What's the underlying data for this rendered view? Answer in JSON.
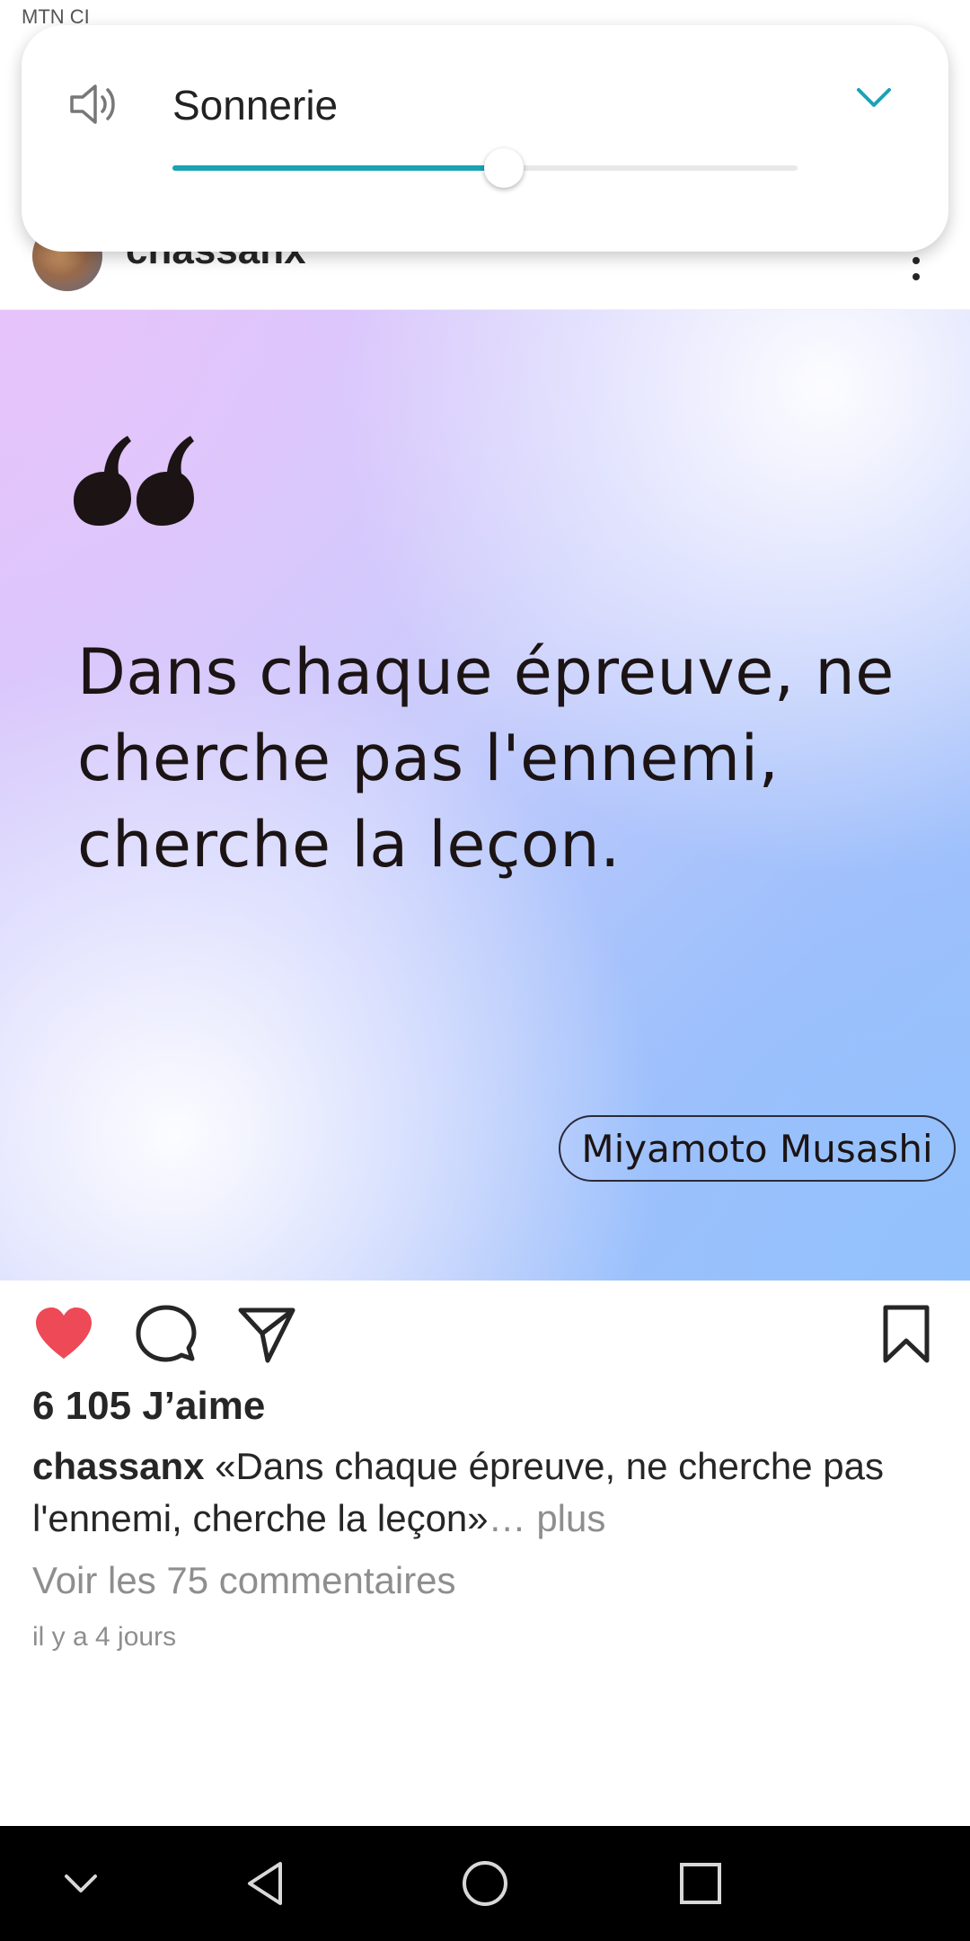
{
  "status_bar": {
    "carrier": "MTN CI"
  },
  "post": {
    "username": "chassanx",
    "quote_text": "Dans chaque épreuve, ne cherche pas l'ennemi, cherche la leçon.",
    "author": "Miyamoto Musashi",
    "likes": "6 105 J’aime",
    "caption_user": "chassanx",
    "caption_text": " «Dans chaque épreuve, ne cherche pas l'ennemi, cherche la leçon»",
    "caption_more": "… plus",
    "comments_link": "Voir les 75 commentaires",
    "timestamp": "il y a 4 jours"
  },
  "volume_panel": {
    "label": "Sonnerie",
    "level_percent": 53,
    "accent_color": "#1aa3b5"
  },
  "icons": {
    "like": "heart-filled-icon",
    "comment": "comment-icon",
    "share": "send-icon",
    "save": "bookmark-icon",
    "nav": [
      "chevron-down-icon",
      "back-icon",
      "home-icon",
      "recents-icon"
    ]
  },
  "colors": {
    "like": "#ed4956",
    "nav_bar": "#000000"
  }
}
